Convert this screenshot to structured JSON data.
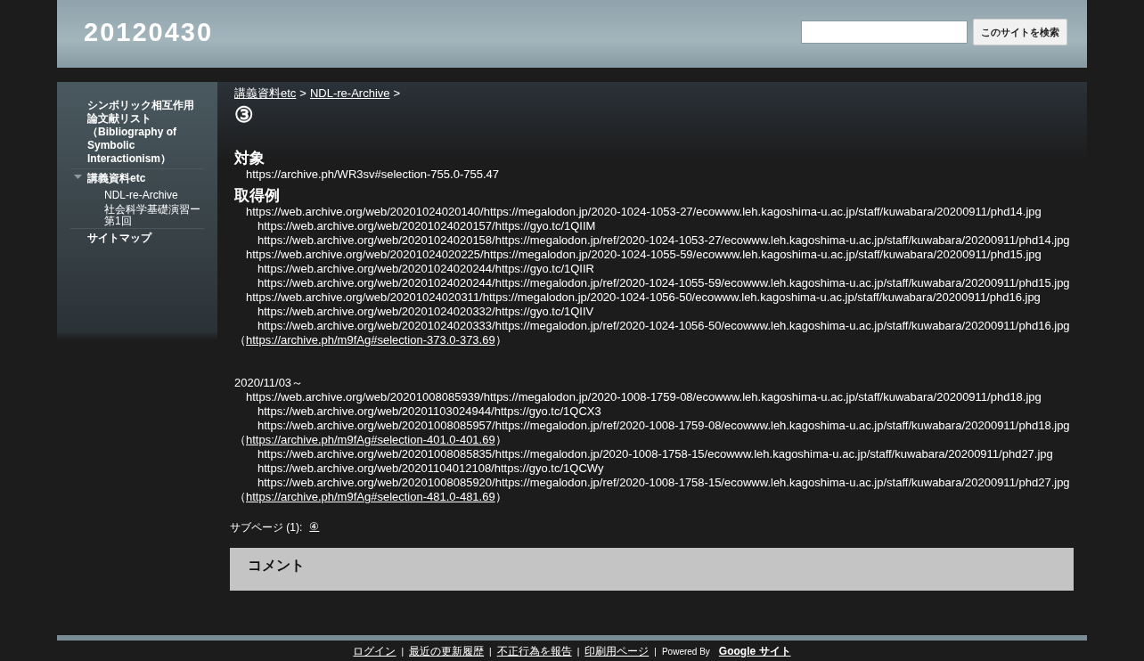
{
  "header": {
    "site_title": "20120430",
    "search": {
      "button": "このサイトを検索"
    }
  },
  "sidebar": {
    "items": [
      {
        "label": "シンボリック相互作用論文献リスト（Bibliography of Symbolic Interactionism）",
        "expanded": false
      },
      {
        "label": "講義資料etc",
        "expanded": true,
        "children": [
          {
            "label": "NDL-re-Archive"
          },
          {
            "label": "社会科学基礎演習ー第1回"
          }
        ]
      },
      {
        "label": "サイトマップ",
        "expanded": false
      }
    ]
  },
  "breadcrumb": [
    {
      "label": "講義資料etc"
    },
    {
      "label": "NDL-re-Archive"
    }
  ],
  "breadcrumb_separator": ">",
  "page_title": "③",
  "content": [
    {
      "kind": "heading",
      "text": "対象"
    },
    {
      "kind": "url",
      "text": "https://archive.ph/WR3sv#selection-755.0-755.47"
    },
    {
      "kind": "heading",
      "text": "取得例"
    },
    {
      "kind": "url",
      "text": "https://web.archive.org/web/20201024020140/https://megalodon.jp/2020-1024-1053-27/ecowww.leh.kagoshima-u.ac.jp/staff/kuwabara/20200911/phd14.jpg"
    },
    {
      "kind": "sub-url",
      "text": "https://web.archive.org/web/20201024020157/https://gyo.tc/1QIIM"
    },
    {
      "kind": "sub-url",
      "text": "https://web.archive.org/web/20201024020158/https://megalodon.jp/ref/2020-1024-1053-27/ecowww.leh.kagoshima-u.ac.jp/staff/kuwabara/20200911/phd14.jpg"
    },
    {
      "kind": "url",
      "text": "https://web.archive.org/web/20201024020225/https://megalodon.jp/2020-1024-1055-59/ecowww.leh.kagoshima-u.ac.jp/staff/kuwabara/20200911/phd15.jpg"
    },
    {
      "kind": "sub-url",
      "text": "https://web.archive.org/web/20201024020244/https://gyo.tc/1QIIR"
    },
    {
      "kind": "sub-url",
      "text": "https://web.archive.org/web/20201024020244/https://megalodon.jp/ref/2020-1024-1055-59/ecowww.leh.kagoshima-u.ac.jp/staff/kuwabara/20200911/phd15.jpg"
    },
    {
      "kind": "url",
      "text": "https://web.archive.org/web/20201024020311/https://megalodon.jp/2020-1024-1056-50/ecowww.leh.kagoshima-u.ac.jp/staff/kuwabara/20200911/phd16.jpg"
    },
    {
      "kind": "sub-url",
      "text": "https://web.archive.org/web/20201024020332/https://gyo.tc/1QIIV"
    },
    {
      "kind": "sub-url",
      "text": "https://web.archive.org/web/20201024020333/https://megalodon.jp/ref/2020-1024-1056-50/ecowww.leh.kagoshima-u.ac.jp/staff/kuwabara/20200911/phd16.jpg"
    },
    {
      "kind": "ref",
      "open": "（",
      "link": "https://archive.ph/m9fAg#selection-373.0-373.69",
      "close": "）"
    },
    {
      "kind": "date",
      "text": "2020/11/03～"
    },
    {
      "kind": "url",
      "text": "https://web.archive.org/web/20201008085939/https://megalodon.jp/2020-1008-1759-08/ecowww.leh.kagoshima-u.ac.jp/staff/kuwabara/20200911/phd18.jpg"
    },
    {
      "kind": "sub-url",
      "text": "https://web.archive.org/web/20201103024944/https://gyo.tc/1QCX3"
    },
    {
      "kind": "sub-url",
      "text": "https://web.archive.org/web/20201008085957/https://megalodon.jp/ref/2020-1008-1759-08/ecowww.leh.kagoshima-u.ac.jp/staff/kuwabara/20200911/phd18.jpg"
    },
    {
      "kind": "ref",
      "open": "（",
      "link": "https://archive.ph/m9fAg#selection-401.0-401.69",
      "close": "）"
    },
    {
      "kind": "sub-url",
      "text": "https://web.archive.org/web/20201008085835/https://megalodon.jp/2020-1008-1758-15/ecowww.leh.kagoshima-u.ac.jp/staff/kuwabara/20200911/phd27.jpg"
    },
    {
      "kind": "sub-url",
      "text": "https://web.archive.org/web/20201104012108/https://gyo.tc/1QCWy"
    },
    {
      "kind": "sub-url",
      "text": "https://web.archive.org/web/20201008085920/https://megalodon.jp/ref/2020-1008-1758-15/ecowww.leh.kagoshima-u.ac.jp/staff/kuwabara/20200911/phd27.jpg"
    },
    {
      "kind": "ref",
      "open": "（",
      "link": "https://archive.ph/m9fAg#selection-481.0-481.69",
      "close": "）"
    }
  ],
  "subpages": {
    "label": "サブページ (1):",
    "links": [
      "④"
    ]
  },
  "comments": {
    "title": "コメント"
  },
  "footer": {
    "links": [
      "ログイン",
      "最近の更新履歴",
      "不正行為を報告",
      "印刷用ページ"
    ],
    "separator": "|",
    "powered_by": "Powered By",
    "brand": "Google サイト"
  }
}
